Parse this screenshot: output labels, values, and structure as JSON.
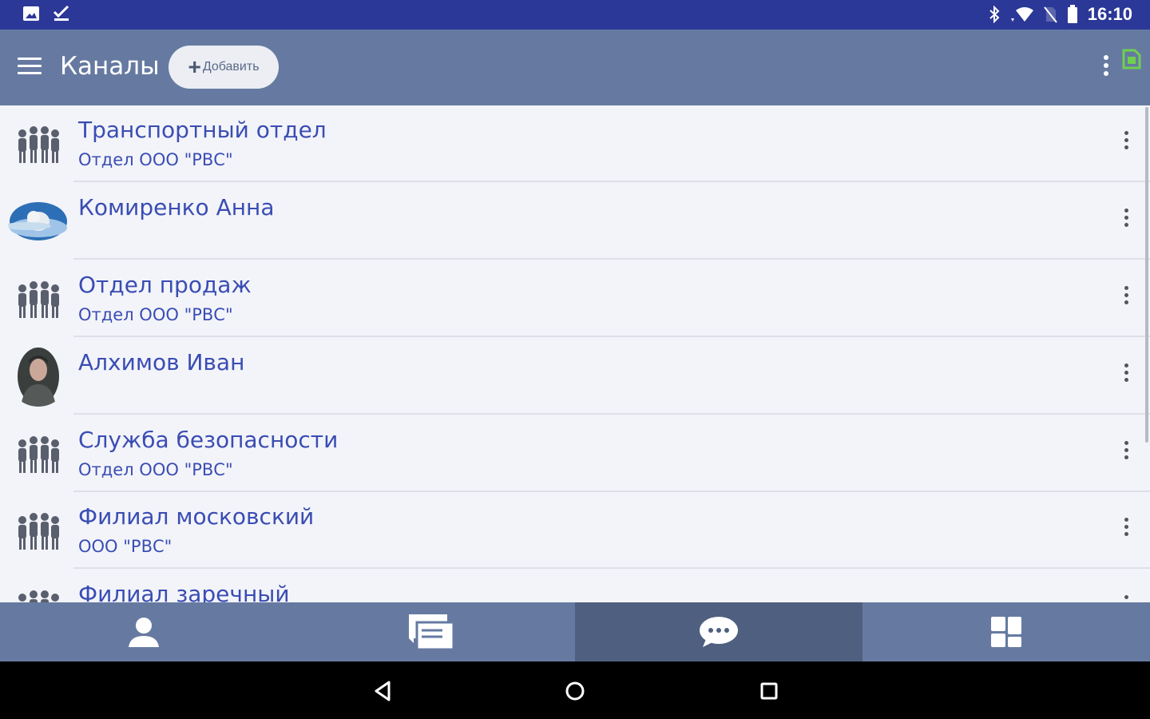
{
  "status_bar": {
    "time": "16:10"
  },
  "app_bar": {
    "title": "Каналы",
    "add_label": "Добавить"
  },
  "channels": [
    {
      "title": "Транспортный отдел",
      "subtitle": "Отдел ООО \"РВС\"",
      "avatar": "group-icon"
    },
    {
      "title": "Комиренко Анна",
      "subtitle": "",
      "avatar": "photo-seal"
    },
    {
      "title": "Отдел продаж",
      "subtitle": "Отдел ООО \"РВС\"",
      "avatar": "group-icon"
    },
    {
      "title": "Алхимов Иван",
      "subtitle": "",
      "avatar": "photo-man"
    },
    {
      "title": "Служба безопасности",
      "subtitle": "Отдел ООО \"РВС\"",
      "avatar": "group-icon"
    },
    {
      "title": "Филиал московский",
      "subtitle": "ООО \"РВС\"",
      "avatar": "group-icon"
    },
    {
      "title": "Филиал заречный",
      "subtitle": "",
      "avatar": "group-icon"
    }
  ],
  "bottom_nav": [
    {
      "icon": "person-icon",
      "active": false
    },
    {
      "icon": "messages-icon",
      "active": false
    },
    {
      "icon": "chat-bubble-icon",
      "active": true
    },
    {
      "icon": "dashboard-icon",
      "active": false
    }
  ],
  "colors": {
    "status_bar": "#2b3897",
    "app_bar": "#667aa1",
    "list_bg": "#f3f4f9",
    "title_text": "#3a4db3",
    "active_tab": "#4f5f80"
  }
}
